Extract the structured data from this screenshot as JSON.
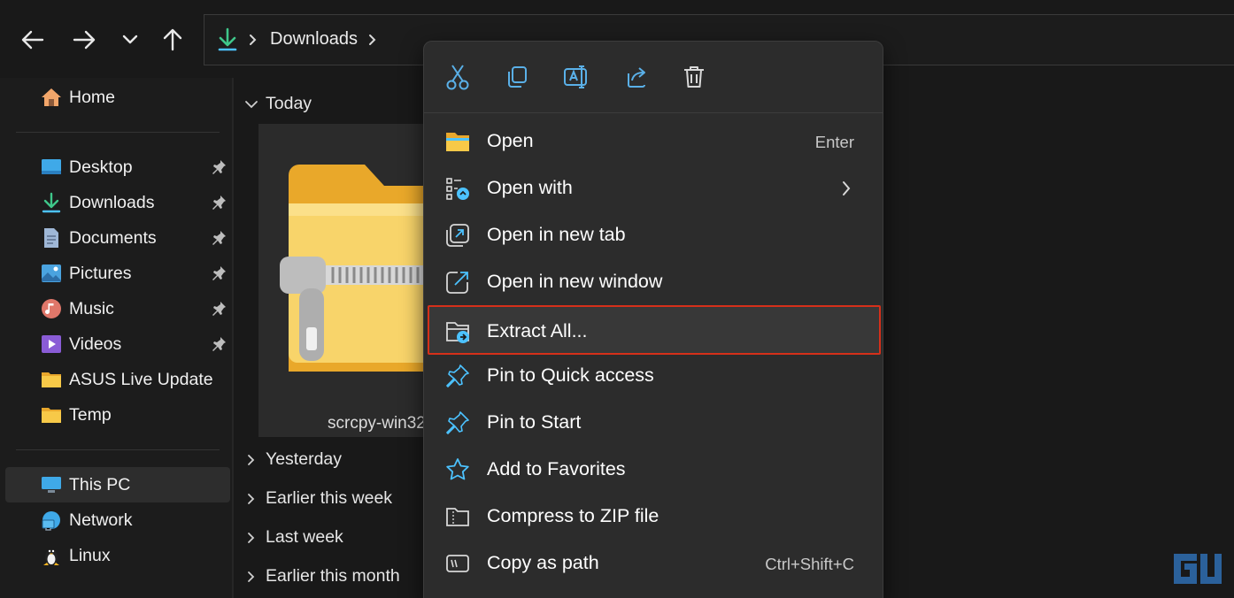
{
  "nav": {
    "back_icon": "arrow-left-icon",
    "forward_icon": "arrow-right-icon",
    "recent_icon": "chevron-down-icon",
    "up_icon": "arrow-up-icon"
  },
  "address_bar": {
    "icon": "download-icon",
    "path": "Downloads"
  },
  "sidebar": {
    "home": "Home",
    "items": [
      {
        "label": "Desktop",
        "icon": "desktop-icon",
        "pinned": true
      },
      {
        "label": "Downloads",
        "icon": "download-icon",
        "pinned": true
      },
      {
        "label": "Documents",
        "icon": "documents-icon",
        "pinned": true
      },
      {
        "label": "Pictures",
        "icon": "pictures-icon",
        "pinned": true
      },
      {
        "label": "Music",
        "icon": "music-icon",
        "pinned": true
      },
      {
        "label": "Videos",
        "icon": "videos-icon",
        "pinned": true
      },
      {
        "label": "ASUS Live Update",
        "icon": "folder-icon",
        "pinned": false
      },
      {
        "label": "Temp",
        "icon": "folder-icon",
        "pinned": false
      }
    ],
    "this_pc": "This PC",
    "network": "Network",
    "linux": "Linux"
  },
  "content": {
    "groups": [
      {
        "label": "Today",
        "expanded": true
      },
      {
        "label": "Yesterday",
        "expanded": false
      },
      {
        "label": "Earlier this week",
        "expanded": false
      },
      {
        "label": "Last week",
        "expanded": false
      },
      {
        "label": "Earlier this month",
        "expanded": false
      }
    ],
    "selected_file": {
      "name": "scrcpy-win32",
      "icon": "zip-folder-icon"
    }
  },
  "context_menu": {
    "quick_actions": [
      {
        "icon": "cut-icon"
      },
      {
        "icon": "copy-icon"
      },
      {
        "icon": "rename-icon"
      },
      {
        "icon": "share-icon"
      },
      {
        "icon": "delete-icon"
      }
    ],
    "items": [
      {
        "label": "Open",
        "shortcut": "Enter",
        "icon": "folder-open-icon"
      },
      {
        "label": "Open with",
        "shortcut": "",
        "icon": "open-with-icon",
        "submenu": true
      },
      {
        "label": "Open in new tab",
        "shortcut": "",
        "icon": "new-tab-icon"
      },
      {
        "label": "Open in new window",
        "shortcut": "",
        "icon": "new-window-icon"
      },
      {
        "label": "Extract All...",
        "shortcut": "",
        "icon": "extract-icon",
        "highlighted": true
      },
      {
        "label": "Pin to Quick access",
        "shortcut": "",
        "icon": "pin-icon"
      },
      {
        "label": "Pin to Start",
        "shortcut": "",
        "icon": "pin-icon"
      },
      {
        "label": "Add to Favorites",
        "shortcut": "",
        "icon": "star-icon"
      },
      {
        "label": "Compress to ZIP file",
        "shortcut": "",
        "icon": "zip-icon"
      },
      {
        "label": "Copy as path",
        "shortcut": "Ctrl+Shift+C",
        "icon": "copy-path-icon"
      }
    ]
  },
  "colors": {
    "accent_blue": "#4cc2ff",
    "highlight_border": "#d6301a",
    "menu_bg": "#2c2c2c"
  },
  "watermark": {
    "icon": "gadgets-to-use-logo"
  }
}
